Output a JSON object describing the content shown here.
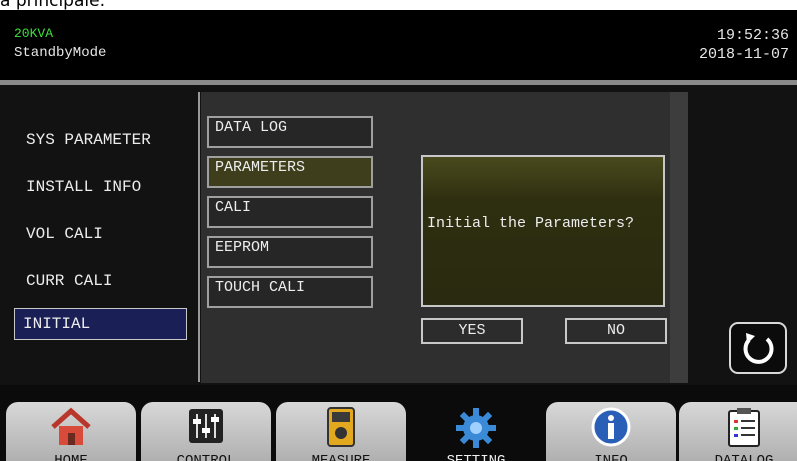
{
  "cropped_caption": "a principale:",
  "header": {
    "model": "20KVA",
    "mode": "StandbyMode",
    "time": "19:52:36",
    "date": "2018-11-07"
  },
  "left_menu": {
    "items": [
      "SYS PARAMETER",
      "INSTALL INFO",
      "VOL CALI",
      "CURR CALI"
    ],
    "selected": "INITIAL"
  },
  "sub_menu": {
    "items": [
      "DATA LOG",
      "PARAMETERS",
      "CALI",
      "EEPROM",
      "TOUCH CALI"
    ],
    "active": "PARAMETERS"
  },
  "dialog": {
    "message": "Initial the Parameters?",
    "yes": "YES",
    "no": "NO"
  },
  "back_button": {
    "icon": "refresh-icon"
  },
  "tabs": {
    "items": [
      {
        "label": "HOME",
        "icon": "home-icon"
      },
      {
        "label": "CONTROL",
        "icon": "sliders-icon"
      },
      {
        "label": "MEASURE",
        "icon": "meter-icon"
      },
      {
        "label": "SETTING",
        "icon": "gear-icon"
      },
      {
        "label": "INFO",
        "icon": "info-icon"
      },
      {
        "label": "DATALOG",
        "icon": "clipboard-icon"
      }
    ],
    "active": "SETTING"
  },
  "colors": {
    "model_text": "#3ee03e",
    "selected_bg": "#1a1f56",
    "active_sub_bg": "#3e3e1c",
    "gear_blue": "#3a8ad8"
  }
}
